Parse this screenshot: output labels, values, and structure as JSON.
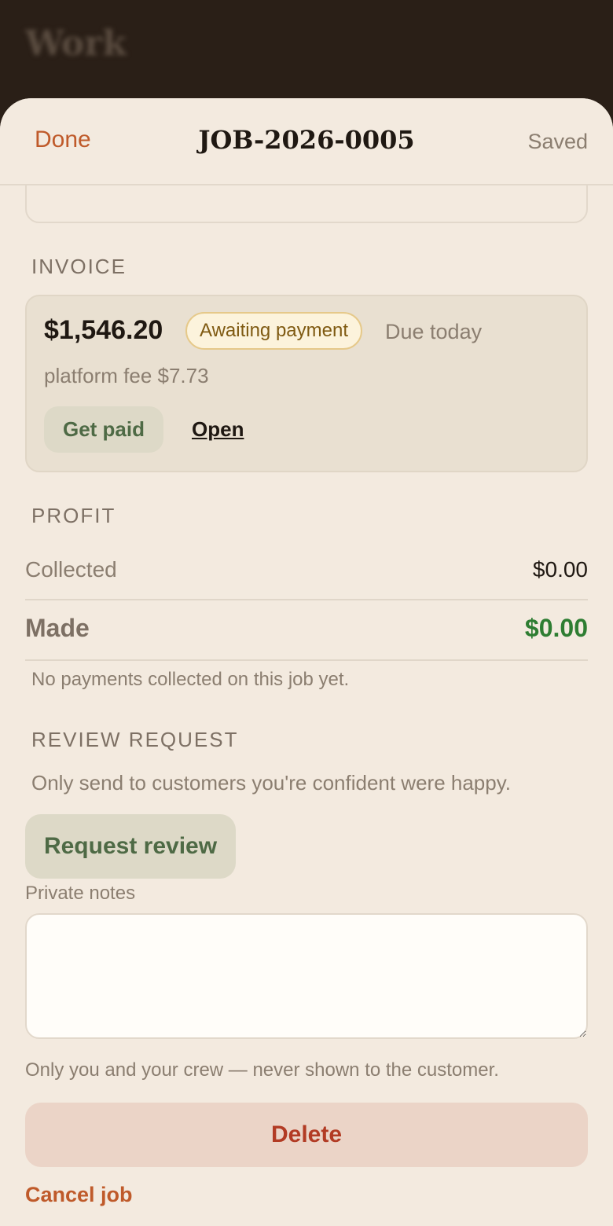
{
  "background": {
    "title": "Work"
  },
  "header": {
    "done_label": "Done",
    "title": "JOB-2026-0005",
    "status": "Saved"
  },
  "invoice": {
    "section_label": "INVOICE",
    "amount": "$1,546.20",
    "status_badge": "Awaiting payment",
    "due": "Due today",
    "fee": "platform fee $7.73",
    "get_paid_label": "Get paid",
    "open_label": "Open"
  },
  "profit": {
    "section_label": "PROFIT",
    "collected_label": "Collected",
    "collected_value": "$0.00",
    "made_label": "Made",
    "made_value": "$0.00",
    "note": "No payments collected on this job yet."
  },
  "review": {
    "section_label": "REVIEW REQUEST",
    "hint": "Only send to customers you're confident were happy.",
    "button_label": "Request review"
  },
  "notes": {
    "label": "Private notes",
    "value": "",
    "helper": "Only you and your crew — never shown to the customer."
  },
  "actions": {
    "delete_label": "Delete",
    "cancel_label": "Cancel job"
  },
  "colors": {
    "accent": "#bf5a2a",
    "profit_positive": "#2e7d32",
    "delete": "#b23b24",
    "badge_text": "#7f5a12"
  }
}
